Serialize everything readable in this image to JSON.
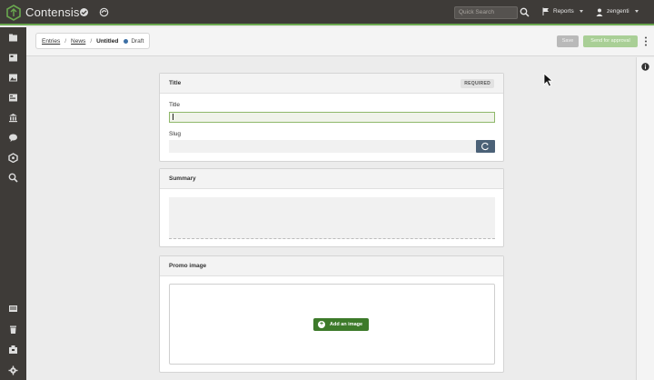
{
  "app": {
    "brand": "Contensis"
  },
  "topbar": {
    "search_placeholder": "Quick Search",
    "reports_label": "Reports",
    "user_label": "zengenti"
  },
  "breadcrumb": {
    "items": [
      "Entries",
      "News"
    ],
    "current": "Untitled",
    "status": "Draft",
    "separator": "/"
  },
  "toolbar": {
    "save_label": "Save",
    "approve_label": "Send for approval"
  },
  "panels": {
    "title": {
      "header": "Title",
      "badge": "REQUIRED",
      "title_label": "Title",
      "title_value": "",
      "slug_label": "Slug"
    },
    "summary": {
      "header": "Summary"
    },
    "promo": {
      "header": "Promo image",
      "add_label": "Add an image"
    }
  },
  "colors": {
    "topbar": "#3e3b38",
    "accent_green": "#6aa84f",
    "primary_button": "#3d7a2a",
    "approve_button": "#a9cf96",
    "slug_button": "#4b6177"
  },
  "icons": {
    "logo": "contensis-logo-icon",
    "topbar": [
      "check-circle-icon",
      "swirl-icon",
      "search-icon",
      "flag-icon"
    ],
    "sidebar": [
      "folder-icon",
      "content-types-icon",
      "image-icon",
      "forms-icon",
      "institution-icon",
      "comment-icon",
      "blocks-icon",
      "search-icon",
      "news-icon",
      "delete-icon",
      "export-icon",
      "settings-icon"
    ]
  }
}
